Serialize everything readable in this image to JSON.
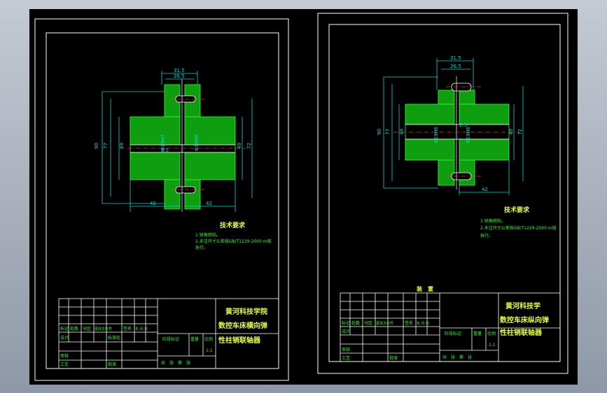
{
  "left_sheet": {
    "dims": {
      "top_outer": "31.5",
      "top_inner": "26.5",
      "d1": "90",
      "d2": "77",
      "d3": "49",
      "d4": "49",
      "d5": "72",
      "gap": "2.5",
      "bore_l": "Φ19H7",
      "bore_r": "Φ19H6",
      "len_l": "42",
      "len_r": "42"
    },
    "tech_title": "技术要求",
    "tech_lines": [
      "1.锐角倒钝。",
      "2.未注尺寸公差按GB/T1229-2000 m级",
      "执行。"
    ],
    "title_block": {
      "school": "黄河科技学院",
      "part_line1": "数控车床横向弹",
      "part_line2": "性柱销联轴器",
      "row_labels": [
        "标记",
        "处数",
        "分区",
        "更改文件号",
        "签名",
        "年.月.日"
      ],
      "design": "设计",
      "std": "标准化",
      "check": "审核",
      "process": "工艺",
      "approve": "批准",
      "stage": "阶段标记",
      "weight": "重量",
      "scale": "比例",
      "scale_val": "1:1",
      "sheets": "共　张　第　张"
    }
  },
  "right_sheet": {
    "dims": {
      "top_outer": "31.5",
      "top_inner": "26.5",
      "d1": "90",
      "d2": "77",
      "d3": "49",
      "d4": "49",
      "d5": "72",
      "gap": "2.5",
      "bore_l": "Φ19H6",
      "bore_r": "Φ19H6",
      "len_r": "42"
    },
    "tech_title": "技术要求",
    "tech_lines": [
      "1.锐角倒钝。",
      "2.未注尺寸公差按GB/T1229-2000 m级",
      "执行。"
    ],
    "heading": "装　置",
    "title_block": {
      "school": "黄河科技学",
      "part_line1": "数控车床纵向弹",
      "part_line2": "性柱销联轴器",
      "row_labels": [
        "标记",
        "处数",
        "分区",
        "更改文件号",
        "签名",
        "年.月.日"
      ],
      "design": "设计",
      "std": "标准化",
      "check": "审核",
      "process": "工艺",
      "approve": "批准",
      "stage": "阶段标记",
      "weight": "重量",
      "scale": "比例",
      "scale_val": "1:1",
      "sheets": "共　张　第　张"
    }
  }
}
